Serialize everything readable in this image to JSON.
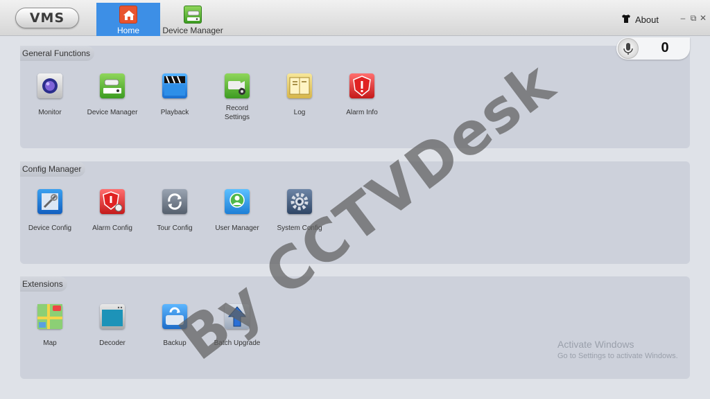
{
  "app": {
    "logo": "VMS"
  },
  "nav": {
    "tabs": [
      {
        "label": "Home",
        "icon": "home-icon",
        "active": true
      },
      {
        "label": "Device Manager",
        "icon": "device-manager-icon",
        "active": false
      }
    ],
    "about_label": "About",
    "window_controls": [
      "–",
      "⧉",
      "✕"
    ]
  },
  "alarm_counter": {
    "value": "0"
  },
  "sections": [
    {
      "title": "General Functions",
      "items": [
        {
          "label": "Monitor",
          "icon": "monitor-icon"
        },
        {
          "label": "Device Manager",
          "icon": "device-manager-icon"
        },
        {
          "label": "Playback",
          "icon": "playback-icon"
        },
        {
          "label": "Record\nSettings",
          "icon": "record-settings-icon"
        },
        {
          "label": "Log",
          "icon": "log-icon"
        },
        {
          "label": "Alarm Info",
          "icon": "alarm-info-icon"
        }
      ]
    },
    {
      "title": "Config Manager",
      "items": [
        {
          "label": "Device Config",
          "icon": "device-config-icon"
        },
        {
          "label": "Alarm Config",
          "icon": "alarm-config-icon"
        },
        {
          "label": "Tour Config",
          "icon": "tour-config-icon"
        },
        {
          "label": "User Manager",
          "icon": "user-manager-icon"
        },
        {
          "label": "System Config",
          "icon": "system-config-icon"
        }
      ]
    },
    {
      "title": "Extensions",
      "items": [
        {
          "label": "Map",
          "icon": "map-icon"
        },
        {
          "label": "Decoder",
          "icon": "decoder-icon"
        },
        {
          "label": "Backup",
          "icon": "backup-icon"
        },
        {
          "label": "Batch Upgrade",
          "icon": "batch-upgrade-icon"
        }
      ]
    }
  ],
  "os_notice": {
    "line1": "Activate Windows",
    "line2": "Go to Settings to activate Windows."
  },
  "watermark": "By CCTVDesk",
  "colors": {
    "accent": "#3d8fe6",
    "panel": "#cdd1db",
    "background": "#dfe2e8"
  }
}
